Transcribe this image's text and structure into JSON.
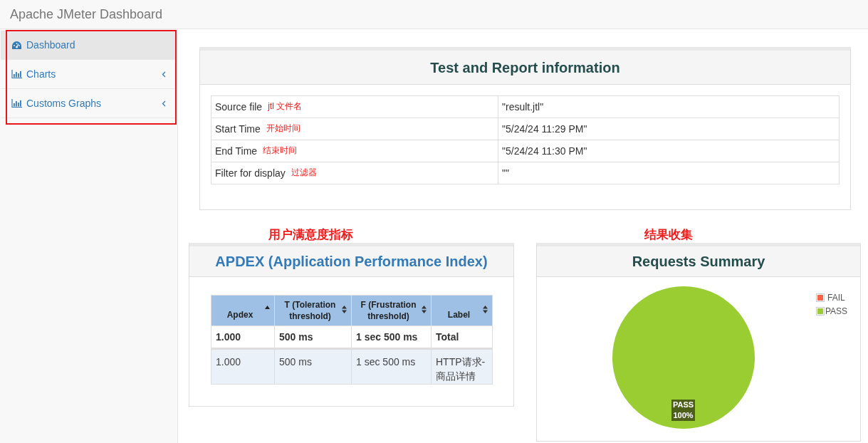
{
  "header": {
    "title": "Apache JMeter Dashboard"
  },
  "sidebar": {
    "highlighted": true,
    "items": [
      {
        "label": "Dashboard",
        "kind": "dashboard",
        "selected": true,
        "has_submenu": false
      },
      {
        "label": "Charts",
        "kind": "chart",
        "selected": false,
        "has_submenu": true
      },
      {
        "label": "Customs Graphs",
        "kind": "chart",
        "selected": false,
        "has_submenu": true
      }
    ]
  },
  "info_panel": {
    "title": "Test and Report information",
    "rows": [
      {
        "label": "Source file",
        "note": "jtl 文件名",
        "value": "\"result.jtl\""
      },
      {
        "label": "Start Time",
        "note": "开始时间",
        "value": "\"5/24/24 11:29 PM\""
      },
      {
        "label": "End Time",
        "note": "结束时间",
        "value": "\"5/24/24 11:30 PM\""
      },
      {
        "label": "Filter for display",
        "note": "过滤器",
        "value": "\"\""
      }
    ]
  },
  "apdex_panel": {
    "note": "用户满意度指标",
    "title": "APDEX (Application Performance Index)",
    "columns": [
      {
        "label": "Apdex",
        "sorted": true
      },
      {
        "label": "T (Toleration threshold)",
        "sorted": false
      },
      {
        "label": "F (Frustration threshold)",
        "sorted": false
      },
      {
        "label": "Label",
        "sorted": false
      }
    ],
    "rows": [
      {
        "kind": "total",
        "cells": [
          "1.000",
          "500 ms",
          "1 sec 500 ms",
          "Total"
        ]
      },
      {
        "kind": "item",
        "cells": [
          "1.000",
          "500 ms",
          "1 sec 500 ms",
          "HTTP请求-商品详情"
        ]
      }
    ]
  },
  "summary_panel": {
    "note": "结果收集",
    "title": "Requests Summary",
    "chart_data": {
      "type": "pie",
      "categories": [
        "FAIL",
        "PASS"
      ],
      "series": [
        {
          "values": [
            0,
            100
          ]
        }
      ],
      "colors": [
        "#ff6347",
        "#9acd32"
      ],
      "value_labels": [
        null,
        "PASS\n100%"
      ]
    }
  }
}
